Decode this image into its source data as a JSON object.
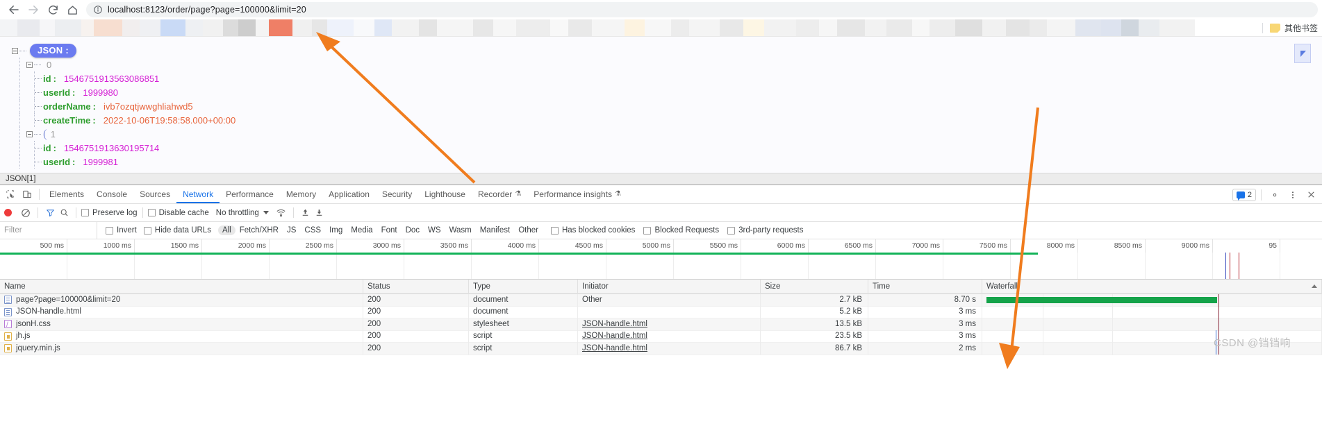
{
  "browser": {
    "back_icon": "arrow-left-icon",
    "forward_icon": "arrow-right-icon",
    "reload_icon": "reload-icon",
    "home_icon": "home-icon",
    "info_icon": "info-circle-icon",
    "url_scheme_host": "localhost:8123",
    "url_path": "/order/page?page=100000&limit=20",
    "url_full": "localhost:8123/order/page?page=100000&limit=20",
    "bookmarks": {
      "other_bookmarks_label": "其他书签",
      "folder_icon": "folder-icon"
    }
  },
  "page": {
    "status_bar": "JSON[1]",
    "root_label": "JSON :",
    "nodes": [
      {
        "index": "0",
        "fields": [
          {
            "key": "id",
            "value": "1546751913563086851",
            "kind": "num"
          },
          {
            "key": "userId",
            "value": "1999980",
            "kind": "num"
          },
          {
            "key": "orderName",
            "value": "ivb7ozqtjwwghliahwd5",
            "kind": "str"
          },
          {
            "key": "createTime",
            "value": "2022-10-06T19:58:58.000+00:00",
            "kind": "str"
          }
        ]
      },
      {
        "index": "1",
        "fields": [
          {
            "key": "id",
            "value": "1546751913630195714",
            "kind": "num"
          },
          {
            "key": "userId",
            "value": "1999981",
            "kind": "num"
          }
        ]
      }
    ]
  },
  "devtools": {
    "inspect_icon": "inspect-element-icon",
    "device_icon": "device-toolbar-icon",
    "tabs": [
      {
        "label": "Elements",
        "active": false
      },
      {
        "label": "Console",
        "active": false
      },
      {
        "label": "Sources",
        "active": false
      },
      {
        "label": "Network",
        "active": true
      },
      {
        "label": "Performance",
        "active": false
      },
      {
        "label": "Memory",
        "active": false
      },
      {
        "label": "Application",
        "active": false
      },
      {
        "label": "Security",
        "active": false
      },
      {
        "label": "Lighthouse",
        "active": false
      },
      {
        "label": "Recorder",
        "active": false,
        "flask": true
      },
      {
        "label": "Performance insights",
        "active": false,
        "flask": true
      }
    ],
    "issues_count": "2",
    "issues_icon": "issues-message-icon",
    "settings_icon": "gear-icon",
    "more_icon": "kebab-menu-icon",
    "close_icon": "close-icon",
    "toolbar": {
      "record_icon": "record-stop-icon",
      "clear_icon": "clear-icon",
      "filter_icon": "filter-funnel-icon",
      "search_icon": "search-icon",
      "preserve_log_label": "Preserve log",
      "preserve_log_checked": false,
      "disable_cache_label": "Disable cache",
      "disable_cache_checked": false,
      "throttling_label": "No throttling",
      "wifi_icon": "network-conditions-icon",
      "import_icon": "import-har-icon",
      "export_icon": "export-har-icon"
    },
    "filterbar": {
      "filter_placeholder": "Filter",
      "invert_label": "Invert",
      "hide_data_urls_label": "Hide data URLs",
      "types": [
        "All",
        "Fetch/XHR",
        "JS",
        "CSS",
        "Img",
        "Media",
        "Font",
        "Doc",
        "WS",
        "Wasm",
        "Manifest",
        "Other"
      ],
      "active_type": "All",
      "has_blocked_cookies_label": "Has blocked cookies",
      "blocked_requests_label": "Blocked Requests",
      "third_party_label": "3rd-party requests"
    },
    "overview": {
      "ticks": [
        "500 ms",
        "1000 ms",
        "1500 ms",
        "2000 ms",
        "2500 ms",
        "3000 ms",
        "3500 ms",
        "4000 ms",
        "4500 ms",
        "5000 ms",
        "5500 ms",
        "6000 ms",
        "6500 ms",
        "7000 ms",
        "7500 ms",
        "8000 ms",
        "8500 ms",
        "9000 ms",
        "95"
      ],
      "green_line_end_pct": 78.5
    },
    "table": {
      "columns": [
        {
          "key": "name",
          "label": "Name"
        },
        {
          "key": "status",
          "label": "Status"
        },
        {
          "key": "type",
          "label": "Type"
        },
        {
          "key": "initiator",
          "label": "Initiator"
        },
        {
          "key": "size",
          "label": "Size"
        },
        {
          "key": "time",
          "label": "Time"
        },
        {
          "key": "waterfall",
          "label": "Waterfall"
        }
      ],
      "rows": [
        {
          "icon": "doc",
          "name": "page?page=100000&limit=20",
          "status": "200",
          "type": "document",
          "initiator": "Other",
          "initiator_link": false,
          "size": "2.7 kB",
          "time": "8.70 s",
          "bar": true
        },
        {
          "icon": "doc",
          "name": "JSON-handle.html",
          "status": "200",
          "type": "document",
          "initiator": "",
          "initiator_link": false,
          "size": "5.2 kB",
          "time": "3 ms",
          "bar": false
        },
        {
          "icon": "css",
          "name": "jsonH.css",
          "status": "200",
          "type": "stylesheet",
          "initiator": "JSON-handle.html",
          "initiator_link": true,
          "size": "13.5 kB",
          "time": "3 ms",
          "bar": false
        },
        {
          "icon": "js",
          "name": "jh.js",
          "status": "200",
          "type": "script",
          "initiator": "JSON-handle.html",
          "initiator_link": true,
          "size": "23.5 kB",
          "time": "3 ms",
          "bar": false
        },
        {
          "icon": "js",
          "name": "jquery.min.js",
          "status": "200",
          "type": "script",
          "initiator": "JSON-handle.html",
          "initiator_link": true,
          "size": "86.7 kB",
          "time": "2 ms",
          "bar": false
        }
      ]
    }
  },
  "watermark": "CSDN @铛铛响",
  "colors": {
    "accent": "#1a73e8",
    "json_badge": "#6b7bf0",
    "key_green": "#2f9e2f",
    "value_magenta": "#d41fd4",
    "value_orange": "#e8643c",
    "waterfall_green": "#15a34a",
    "record_red": "#ee3b3b",
    "arrow_orange": "#f07c1e"
  },
  "annotations": {
    "arrow_1": "orange-arrow-pointing-to-address-bar",
    "arrow_2": "orange-arrow-pointing-to-time-column"
  }
}
